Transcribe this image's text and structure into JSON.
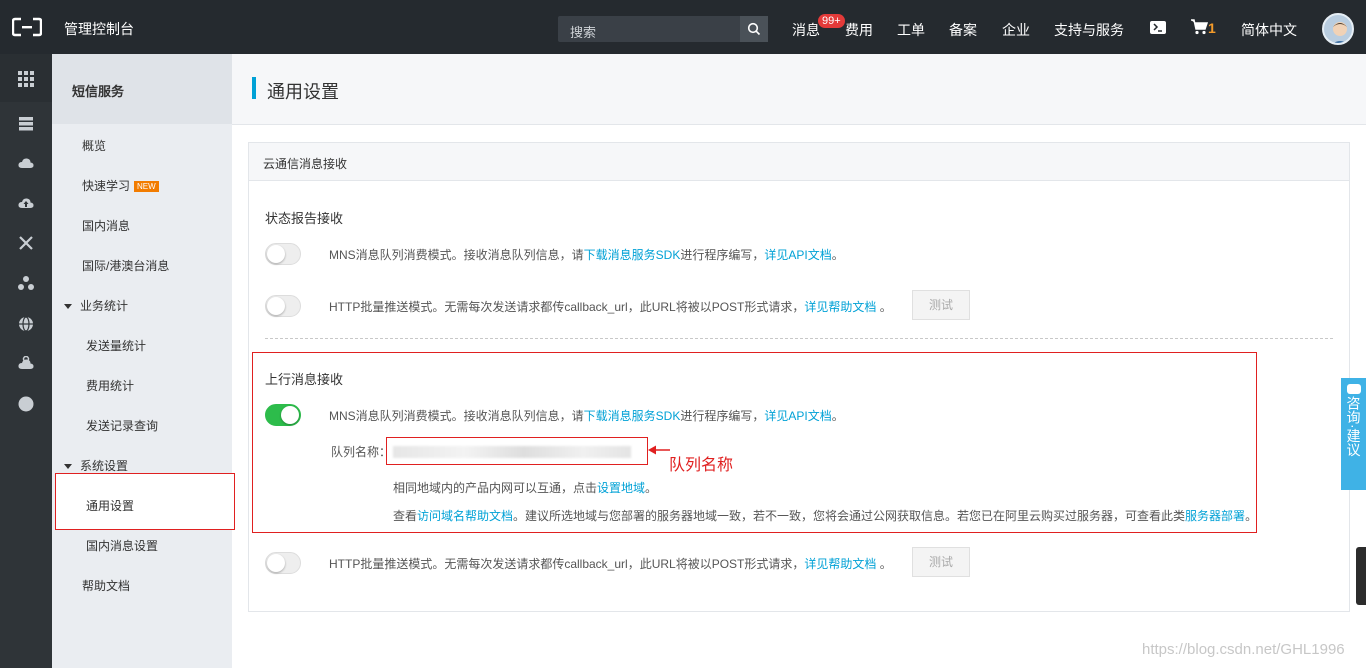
{
  "topbar": {
    "console_title": "管理控制台",
    "search_placeholder": "搜索",
    "nav": {
      "messages": "消息",
      "messages_badge": "99+",
      "billing": "费用",
      "tickets": "工单",
      "icp": "备案",
      "enterprise": "企业",
      "support": "支持与服务",
      "cart_count": "1",
      "language": "简体中文"
    }
  },
  "rail": {
    "icons": [
      "grid-icon",
      "server-icon",
      "cloud-icon",
      "cloud-upload-icon",
      "network-icon",
      "nodes-icon",
      "globe-icon",
      "gear-cloud-icon",
      "circle-icon"
    ]
  },
  "sidebar": {
    "service_title": "短信服务",
    "items": {
      "overview": "概览",
      "quick_start": "快速学习",
      "quick_start_badge": "NEW",
      "domestic": "国内消息",
      "international": "国际/港澳台消息",
      "stats_group": "业务统计",
      "send_stats": "发送量统计",
      "fee_stats": "费用统计",
      "send_records": "发送记录查询",
      "settings_group": "系统设置",
      "general_settings": "通用设置",
      "domestic_settings": "国内消息设置",
      "help_docs": "帮助文档"
    }
  },
  "main": {
    "page_title": "通用设置",
    "card_title": "云通信消息接收",
    "status_report": {
      "title": "状态报告接收",
      "mns": {
        "text_a": "MNS消息队列消费模式。接收消息队列信息，请",
        "link_sdk": "下载消息服务SDK",
        "text_b": "进行程序编写，",
        "link_api": "详见API文档",
        "text_c": "。",
        "enabled": false
      },
      "http": {
        "text_a": "HTTP批量推送模式。无需每次发送请求都传callback_url，此URL将被以POST形式请求，",
        "link_help": "详见帮助文档",
        "text_c": " 。",
        "test_label": "测试",
        "enabled": false
      }
    },
    "upstream": {
      "title": "上行消息接收",
      "mns": {
        "text_a": "MNS消息队列消费模式。接收消息队列信息，请",
        "link_sdk": "下载消息服务SDK",
        "text_b": "进行程序编写，",
        "link_api": "详见API文档",
        "text_c": "。",
        "enabled": true
      },
      "queue_label": "队列名称：",
      "annotation": "队列名称",
      "region_hint_a": "相同地域内的产品内网可以互通，点击",
      "region_link": "设置地域",
      "region_hint_b": "。",
      "domain_hint_a": "查看",
      "domain_link": "访问域名帮助文档",
      "domain_hint_b": "。建议所选地域与您部署的服务器地域一致，若不一致，您将会通过公网获取信息。若您已在阿里云购买过服务器，可查看此类",
      "server_link": "服务器部署",
      "domain_hint_c": "。",
      "http": {
        "text_a": "HTTP批量推送模式。无需每次发送请求都传callback_url，此URL将被以POST形式请求，",
        "link_help": "详见帮助文档",
        "text_c": " 。",
        "test_label": "测试",
        "enabled": false
      }
    }
  },
  "feedback": {
    "label": "咨询·建议"
  },
  "watermark": "https://blog.csdn.net/GHL1996"
}
